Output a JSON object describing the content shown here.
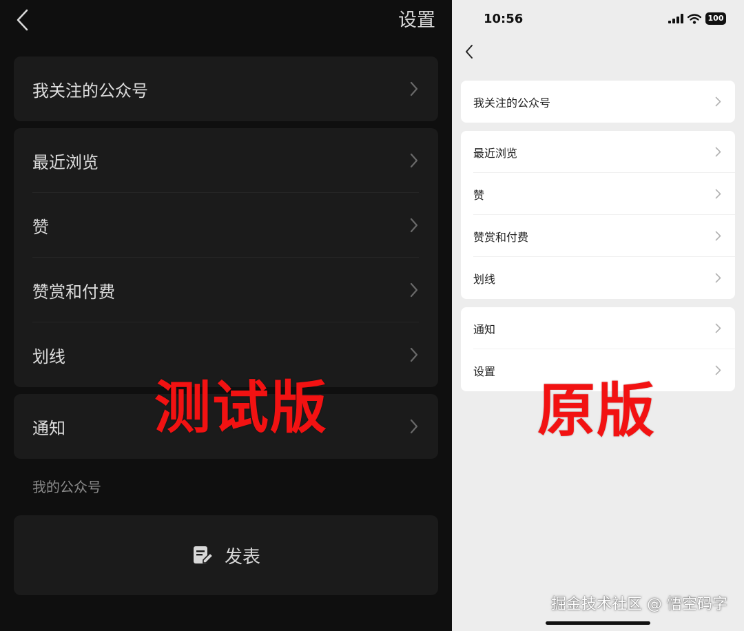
{
  "left": {
    "title": "设置",
    "card1": [
      "我关注的公众号"
    ],
    "card2": [
      "最近浏览",
      "赞",
      "赞赏和付费",
      "划线"
    ],
    "card3": [
      "通知"
    ],
    "section_label": "我的公众号",
    "publish_label": "发表",
    "stamp": "测试版"
  },
  "right": {
    "status": {
      "time": "10:56",
      "battery": "100"
    },
    "card1": [
      "我关注的公众号"
    ],
    "card2": [
      "最近浏览",
      "赞",
      "赞赏和付费",
      "划线"
    ],
    "card3": [
      "通知",
      "设置"
    ],
    "stamp": "原版",
    "watermark": "掘金技术社区 @ 悟空码字"
  },
  "colors": {
    "dark_bg": "#0f0f0f",
    "dark_card": "#1b1b1b",
    "light_bg": "#ededed",
    "light_card": "#ffffff",
    "stamp_red": "#f21212"
  },
  "icons": {
    "back": "chevron-left-icon",
    "row_arrow": "chevron-right-icon",
    "publish": "edit-document-icon",
    "signal": "cellular-signal-icon",
    "wifi": "wifi-icon",
    "battery": "battery-icon"
  }
}
